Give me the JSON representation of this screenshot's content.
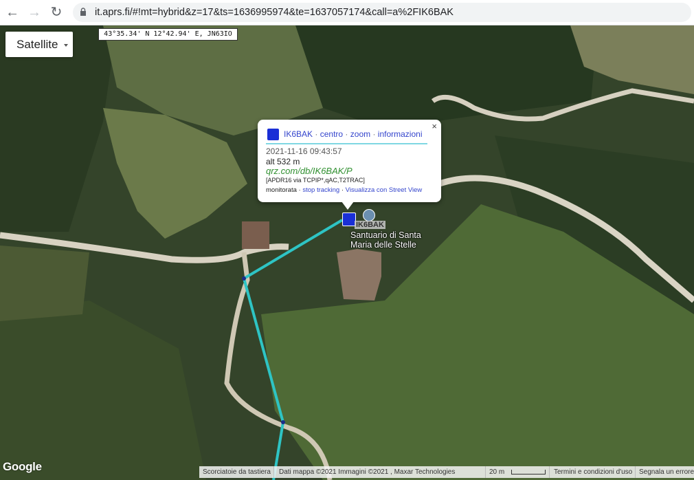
{
  "browser": {
    "url": "it.aprs.fi/#!mt=hybrid&z=17&ts=1636995974&te=1637057174&call=a%2FIK6BAK"
  },
  "map": {
    "type_button": "Satellite",
    "coordinates": "43°35.34' N 12°42.94' E, JN63IO",
    "poi_label_line1": "Santuario di Santa",
    "poi_label_line2": "Maria delle Stelle",
    "station_label": "IK6BAK",
    "google_logo": "Google",
    "track_color": "#2ec4c4",
    "footer": {
      "keyboard": "Scorciatoie da tastiera",
      "data": "Dati mappa ©2021 Immagini ©2021 , Maxar Technologies",
      "scale": "20 m",
      "terms": "Termini e condizioni d'uso",
      "report": "Segnala un errore"
    }
  },
  "popup": {
    "callsign": "IK6BAK",
    "links": [
      "centro",
      "zoom",
      "informazioni"
    ],
    "timestamp": "2021-11-16 09:43:57",
    "altitude": "alt 532 m",
    "qrz_link": "qrz.com/db/IK6BAK/P",
    "path": "[APDR16 via TCPIP*,qAC,T2TRAC]",
    "monitor_label": "monitorata",
    "stop_tracking": "stop tracking",
    "street_view": "Visualizza con Street View",
    "close_glyph": "×"
  }
}
